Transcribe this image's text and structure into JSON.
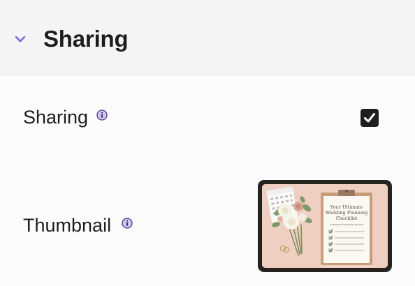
{
  "section": {
    "title": "Sharing",
    "expanded": true,
    "toggle_icon": "chevron-down-icon",
    "accent_color": "#7b5ce0"
  },
  "rows": {
    "sharing": {
      "label": "Sharing",
      "info_icon": "info-icon",
      "checked": true
    },
    "thumbnail": {
      "label": "Thumbnail",
      "info_icon": "info-icon",
      "image": {
        "title_line1": "Your Ultimate",
        "title_line2": "Wedding Planning",
        "title_line3": "Checklist",
        "subtitle": "12 Months of Stress-Free Planning"
      }
    }
  }
}
